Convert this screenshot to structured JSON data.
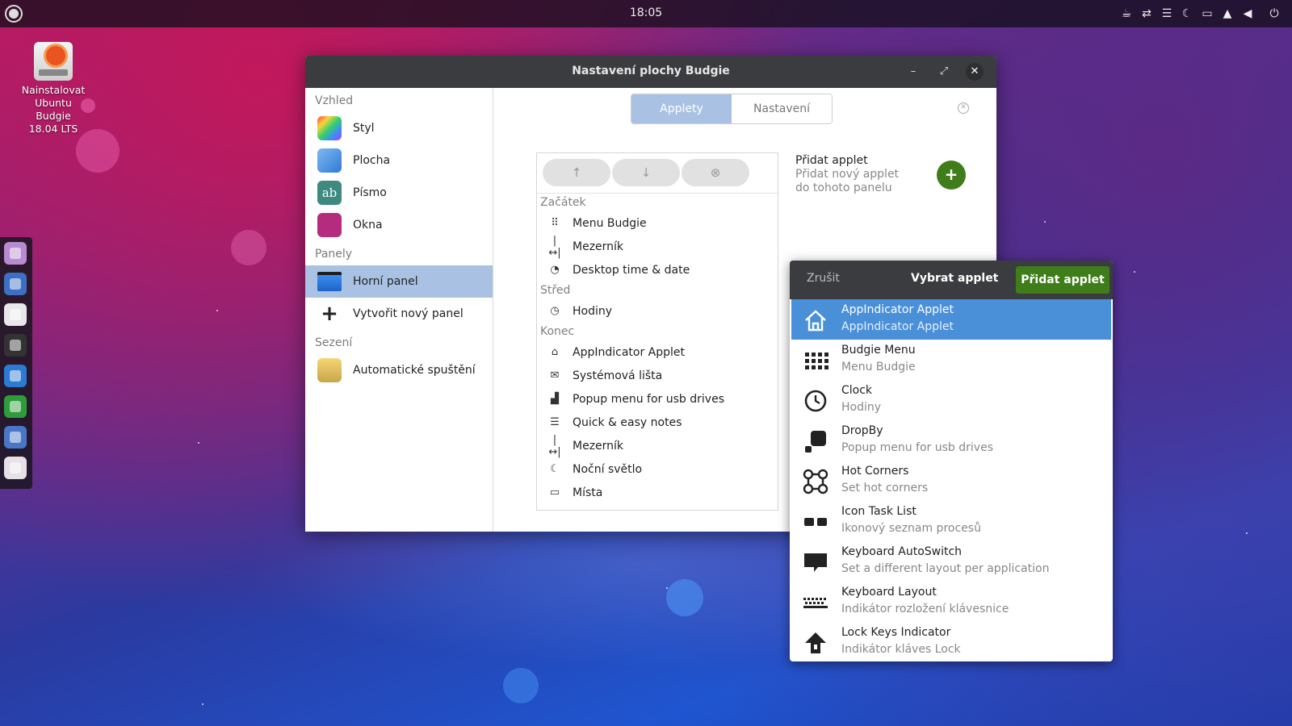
{
  "topbar": {
    "clock": "18:05",
    "tray_icons": [
      "coffee-icon",
      "network-arrows-icon",
      "list-icon",
      "moon-icon",
      "folder-icon",
      "bell-icon",
      "volume-icon",
      "power-icon"
    ]
  },
  "desktop_icon": {
    "label_lines": [
      "Nainstalovat",
      "Ubuntu",
      "Budgie",
      "18.04 LTS"
    ]
  },
  "dock": {
    "items": [
      "files-icon",
      "web-browser-icon",
      "music-icon",
      "terminal-icon",
      "writer-icon",
      "calc-icon",
      "chrome-icon",
      "settings-toggle-icon"
    ]
  },
  "window": {
    "title": "Nastavení plochy Budgie",
    "sidebar": {
      "sections": [
        {
          "label": "Vzhled",
          "items": [
            {
              "label": "Styl",
              "icon": "palette-icon"
            },
            {
              "label": "Plocha",
              "icon": "desktop-icon"
            },
            {
              "label": "Písmo",
              "icon": "font-icon"
            },
            {
              "label": "Okna",
              "icon": "windows-icon"
            }
          ]
        },
        {
          "label": "Panely",
          "items": [
            {
              "label": "Horní panel",
              "icon": "panel-icon",
              "active": true
            },
            {
              "label": "Vytvořit nový panel",
              "icon": "plus-icon"
            }
          ]
        },
        {
          "label": "Sezení",
          "items": [
            {
              "label": "Automatické spuštění",
              "icon": "autostart-icon"
            }
          ]
        }
      ]
    },
    "tabs": [
      {
        "label": "Applety",
        "active": true
      },
      {
        "label": "Nastavení",
        "active": false
      }
    ],
    "applet_list": {
      "groups": [
        {
          "label": "Začátek",
          "items": [
            {
              "label": "Menu Budgie",
              "icon": "grid-icon"
            },
            {
              "label": "Mezerník",
              "icon": "spacer-icon"
            },
            {
              "label": "Desktop time & date",
              "icon": "clock-pie-icon"
            }
          ]
        },
        {
          "label": "Střed",
          "items": [
            {
              "label": "Hodiny",
              "icon": "clock-icon"
            }
          ]
        },
        {
          "label": "Konec",
          "items": [
            {
              "label": "AppIndicator Applet",
              "icon": "home-icon"
            },
            {
              "label": "Systémová lišta",
              "icon": "envelope-icon"
            },
            {
              "label": "Popup menu for usb drives",
              "icon": "dropby-icon"
            },
            {
              "label": "Quick & easy notes",
              "icon": "list-icon"
            },
            {
              "label": "Mezerník",
              "icon": "spacer-icon"
            },
            {
              "label": "Noční světlo",
              "icon": "moon-icon"
            },
            {
              "label": "Místa",
              "icon": "folder-icon"
            }
          ]
        }
      ]
    },
    "add_applet": {
      "title": "Přidat applet",
      "description": "Přidat nový applet do tohoto panelu"
    }
  },
  "popover": {
    "cancel_label": "Zrušit",
    "title": "Vybrat applet",
    "add_label": "Přidat applet",
    "applets": [
      {
        "name": "AppIndicator Applet",
        "desc": "AppIndicator Applet",
        "icon": "home-icon",
        "selected": true
      },
      {
        "name": "Budgie Menu",
        "desc": "Menu Budgie",
        "icon": "grid-icon"
      },
      {
        "name": "Clock",
        "desc": "Hodiny",
        "icon": "clock-icon"
      },
      {
        "name": "DropBy",
        "desc": "Popup menu for usb drives",
        "icon": "dropby-icon"
      },
      {
        "name": "Hot Corners",
        "desc": "Set hot corners",
        "icon": "hot-corners-icon"
      },
      {
        "name": "Icon Task List",
        "desc": "Ikonový seznam procesů",
        "icon": "task-list-icon"
      },
      {
        "name": "Keyboard AutoSwitch",
        "desc": "Set a different layout per application",
        "icon": "speech-bubble-icon"
      },
      {
        "name": "Keyboard Layout",
        "desc": "Indikátor rozložení klávesnice",
        "icon": "keyboard-icon"
      },
      {
        "name": "Lock Keys Indicator",
        "desc": "Indikátor kláves Lock",
        "icon": "lock-keys-icon"
      }
    ]
  }
}
